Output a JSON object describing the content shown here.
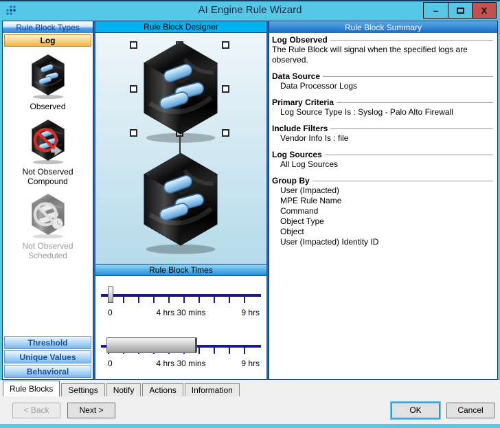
{
  "window": {
    "title": "AI Engine Rule Wizard",
    "controls": {
      "minimize": "–",
      "maximize": "□",
      "close": "X"
    }
  },
  "left_panel": {
    "header": "Rule Block Types",
    "selected_type": "Log",
    "types": [
      {
        "label": "Observed",
        "icon": "cube-logs-icon",
        "enabled": true
      },
      {
        "label": "Not Observed Compound",
        "icon": "cube-not-observed-icon",
        "enabled": true
      },
      {
        "label": "Not Observed Scheduled",
        "icon": "cube-scheduled-icon",
        "enabled": false
      }
    ],
    "categories": [
      "Threshold",
      "Unique Values",
      "Behavioral"
    ]
  },
  "designer": {
    "header": "Rule Block Designer"
  },
  "times": {
    "header": "Rule Block Times",
    "sliders": [
      {
        "labels": [
          "0",
          "4 hrs 30 mins",
          "9 hrs"
        ],
        "thumb_position": "0"
      },
      {
        "labels": [
          "0",
          "4 hrs 30 mins",
          "9 hrs"
        ],
        "range_end": "4 hrs 30 mins"
      }
    ]
  },
  "summary": {
    "header": "Rule Block Summary",
    "sections": [
      {
        "title": "Log Observed",
        "lines": [
          "The Rule Block will signal when the specified logs are observed."
        ]
      },
      {
        "title": "Data Source",
        "lines": [
          "Data Processor Logs"
        ]
      },
      {
        "title": "Primary Criteria",
        "lines": [
          "Log Source Type Is : Syslog - Palo Alto Firewall"
        ]
      },
      {
        "title": "Include Filters",
        "lines": [
          "Vendor Info Is : file"
        ]
      },
      {
        "title": "Log Sources",
        "lines": [
          "All Log Sources"
        ]
      },
      {
        "title": "Group By",
        "lines": [
          "User (Impacted)",
          "MPE Rule Name",
          "Command",
          "Object Type",
          "Object",
          "User (Impacted) Identity ID"
        ]
      }
    ]
  },
  "tabs": [
    "Rule Blocks",
    "Settings",
    "Notify",
    "Actions",
    "Information"
  ],
  "buttons": {
    "back": "< Back",
    "next": "Next >",
    "ok": "OK",
    "cancel": "Cancel"
  },
  "colors": {
    "titlebar": "#57c7e7",
    "close_button": "#c0534f",
    "selected_type_orange": "#f4b045",
    "header_blue": "#2f87dd",
    "designer_header_cyan": "#00b2ef",
    "slider_track_navy": "#1a1a8c"
  }
}
